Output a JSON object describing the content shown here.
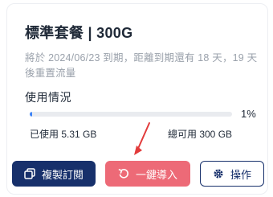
{
  "plan": {
    "title": "標準套餐 | 300G",
    "notice": "將於 2024/06/23 到期，距離到期還有 18 天，19 天後重置流量"
  },
  "usage": {
    "heading": "使用情況",
    "percent_label": "1%",
    "percent_value": 1,
    "used": "已使用 5.31 GB",
    "total": "總可用 300 GB"
  },
  "actions": {
    "copy_label": "複製訂閱",
    "import_label": "一鍵導入",
    "ops_label": "操作"
  },
  "colors": {
    "primary": "#17306b",
    "import": "#ed6a77",
    "progress": "#3b82f6",
    "annotation_arrow": "#e23b3b"
  },
  "icons": {
    "copy": "copy-icon",
    "import": "import-icon",
    "ops": "gear-icon"
  }
}
